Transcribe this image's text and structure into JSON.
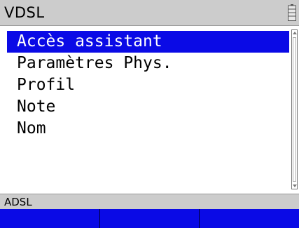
{
  "title_bar": {
    "title": "VDSL"
  },
  "menu": {
    "items": [
      {
        "label": "Accès assistant",
        "selected": true
      },
      {
        "label": "Paramètres Phys.",
        "selected": false
      },
      {
        "label": "Profil",
        "selected": false
      },
      {
        "label": "Note",
        "selected": false
      },
      {
        "label": "Nom",
        "selected": false
      }
    ]
  },
  "status_bar": {
    "text": "ADSL"
  },
  "softkeys": [
    {
      "label": ""
    },
    {
      "label": ""
    },
    {
      "label": ""
    }
  ],
  "icons": {
    "battery": "battery-icon",
    "scroll_up": "chevron-up-icon",
    "scroll_down": "chevron-down-icon"
  },
  "colors": {
    "accent": "#0a0ae6",
    "title_bar_bg": "#cccccc"
  }
}
